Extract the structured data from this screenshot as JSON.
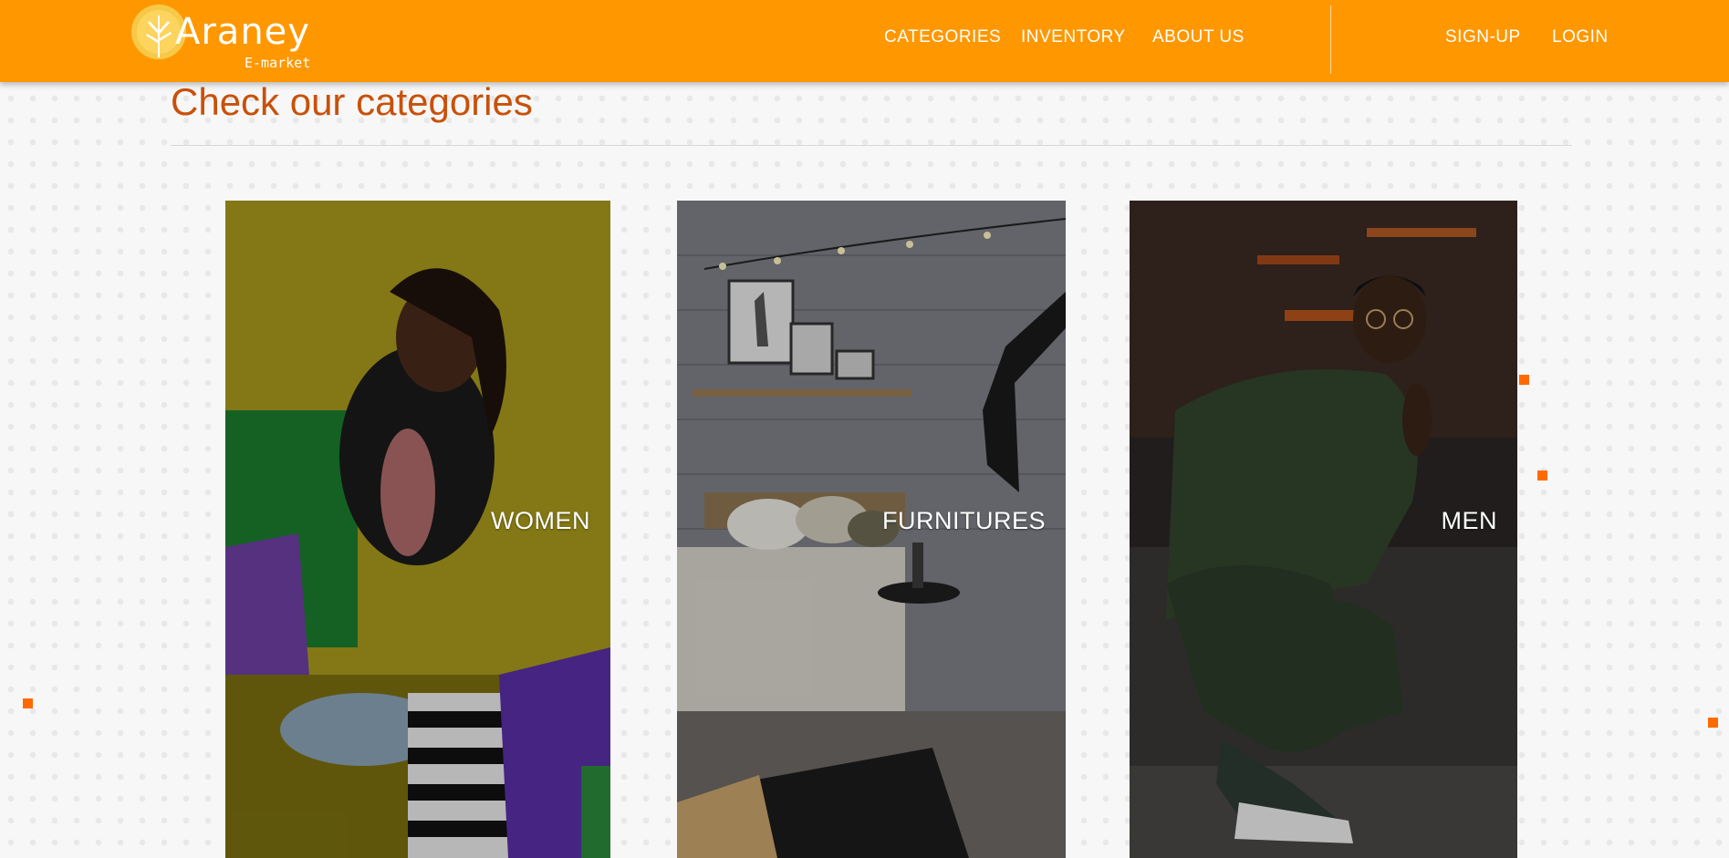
{
  "brand": {
    "name": "Araney",
    "tagline": "E-market",
    "color": "#ff9800"
  },
  "nav": {
    "categories": "CATEGORIES",
    "inventory": "INVENTORY",
    "about": "ABOUT US",
    "signup": "SIGN-UP",
    "login": "LOGIN"
  },
  "main": {
    "heading": "Check our categories",
    "heading_color": "#c8510a"
  },
  "categories": [
    {
      "label": "WOMEN",
      "image": "woman-with-shopping-bags"
    },
    {
      "label": "FURNITURES",
      "image": "bedroom-interior"
    },
    {
      "label": "MEN",
      "image": "man-crouching-with-glasses"
    }
  ]
}
